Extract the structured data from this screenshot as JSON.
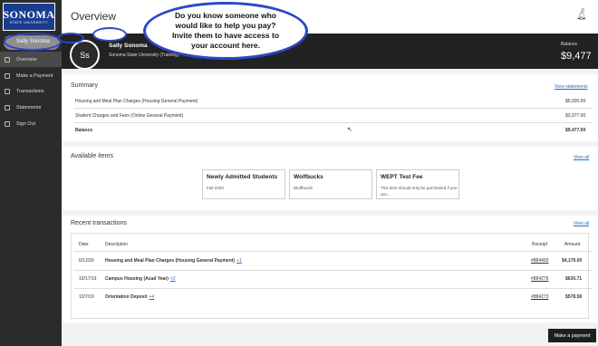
{
  "logo": {
    "title": "SONOMA",
    "subtitle": "STATE UNIVERSITY"
  },
  "sidebar": {
    "user": "Sally Sonoma",
    "items": [
      {
        "label": "Overview",
        "icon": "home-icon"
      },
      {
        "label": "Make a Payment",
        "icon": "payment-icon"
      },
      {
        "label": "Transactions",
        "icon": "transactions-icon"
      },
      {
        "label": "Statements",
        "icon": "statements-icon"
      },
      {
        "label": "Sign Out",
        "icon": "sign-out-icon"
      }
    ]
  },
  "header": {
    "title": "Overview",
    "notification_count": "0"
  },
  "banner": {
    "avatar_initials": "Ss",
    "name": "Sally Sonoma",
    "school": "Sonoma State University (Training)",
    "balance_label": "Balance",
    "balance": "$9,477"
  },
  "summary": {
    "title": "Summary",
    "link": "View statements",
    "rows": [
      {
        "label": "Housing and Meal Plan Charges (Housing General Payment)",
        "amount": "$5,500.00"
      },
      {
        "label": "Student Charges and Fees (Online General Payment)",
        "amount": "$3,977.00"
      }
    ],
    "total_label": "Balance",
    "total": "$9,477.00"
  },
  "available": {
    "title": "Available items",
    "link": "View all",
    "cards": [
      {
        "title": "Newly Admitted Students",
        "subtitle": "Fall 2020"
      },
      {
        "title": "Wolfbucks",
        "subtitle": "Wolfbucks"
      },
      {
        "title": "WEPT Test Fee",
        "subtitle": "This item should only be purchased if you are..."
      }
    ]
  },
  "recent": {
    "title": "Recent transactions",
    "link": "View all",
    "columns": {
      "date": "Date",
      "description": "Description",
      "receipt": "Receipt",
      "amount": "Amount"
    },
    "rows": [
      {
        "date": "6/12/20",
        "description": "Housing and Meal Plan Charges (Housing General Payment)",
        "more": "+1",
        "receipt": "#884493",
        "amount": "$4,170.00"
      },
      {
        "date": "10/17/19",
        "description": "Campus Housing (Acad Year)",
        "more": "+2",
        "receipt": "#884276",
        "amount": "$630.71"
      },
      {
        "date": "10/7/19",
        "description": "Orientation Deposit",
        "more": "+4",
        "receipt": "#884273",
        "amount": "$578.58"
      }
    ]
  },
  "footer": {
    "make_payment": "Make a payment"
  },
  "callout": {
    "text": "Do you know someone who would like to help you pay? Invite them to have access to your account here."
  },
  "colors": {
    "accent": "#2c47c8",
    "link": "#2a6ebb",
    "sidebar": "#2b2b2b",
    "banner": "#222222",
    "logo": "#1a3d8f"
  }
}
